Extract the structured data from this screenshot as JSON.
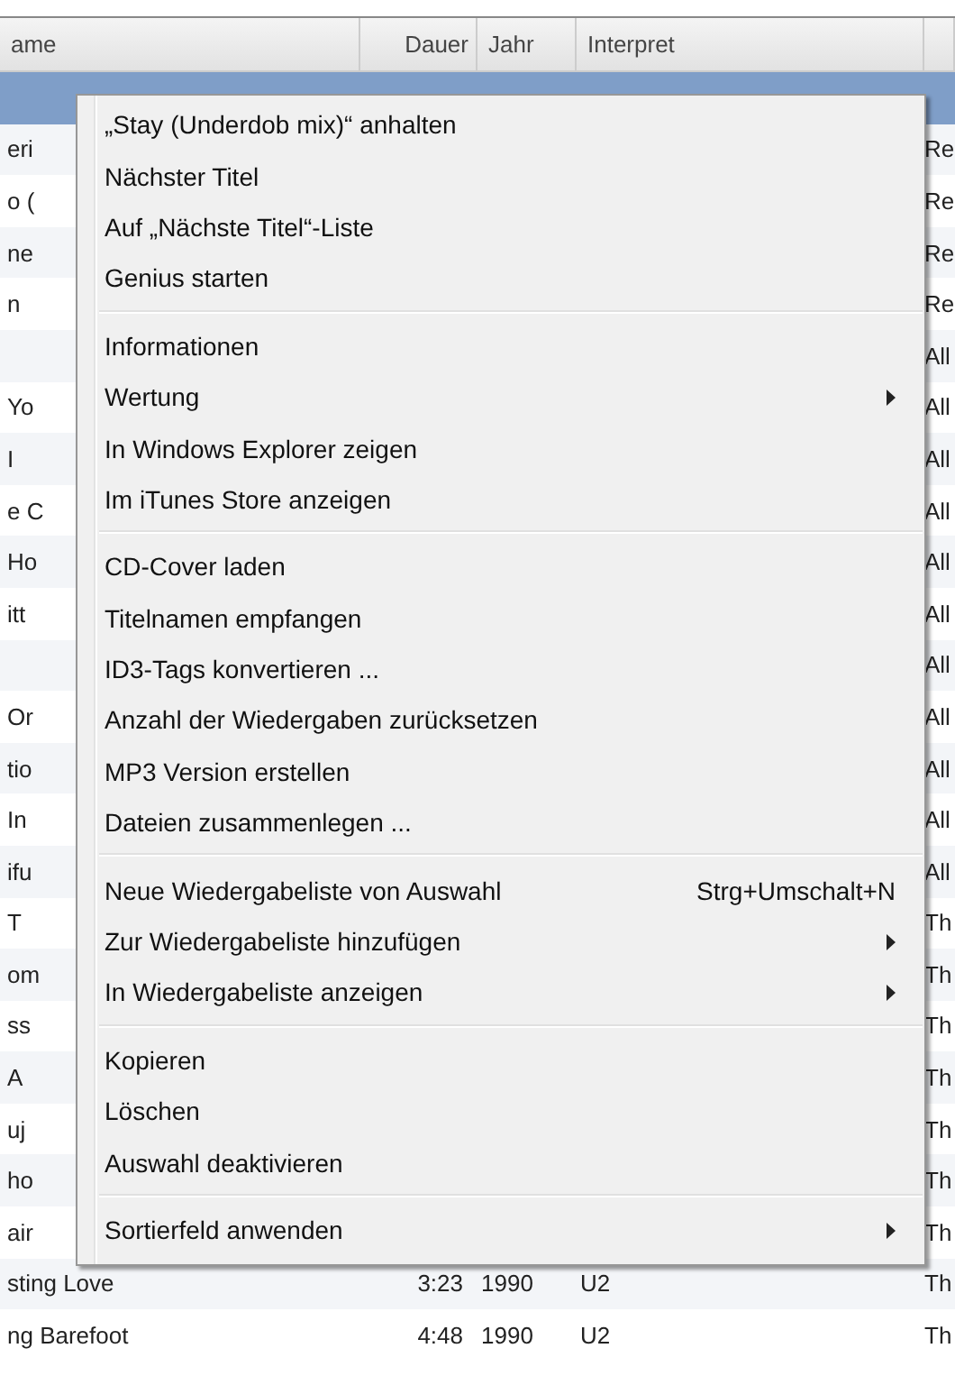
{
  "columns": [
    "ame",
    "Dauer",
    "Jahr",
    "Interpret"
  ],
  "rows": [
    {
      "name": "",
      "duration": "",
      "year": "",
      "artist": "",
      "album": "",
      "selected": true
    },
    {
      "name": "eri",
      "duration": "",
      "year": "",
      "artist": "",
      "album": "Re",
      "selected": false
    },
    {
      "name": "o (",
      "duration": "",
      "year": "",
      "artist": "",
      "album": "Re",
      "selected": false
    },
    {
      "name": "ne",
      "duration": "",
      "year": "",
      "artist": "",
      "album": "Re",
      "selected": false
    },
    {
      "name": "n",
      "duration": "",
      "year": "",
      "artist": "",
      "album": "Re",
      "selected": false
    },
    {
      "name": "",
      "duration": "",
      "year": "",
      "artist": "",
      "album": "All",
      "selected": false
    },
    {
      "name": "Yo",
      "duration": "",
      "year": "",
      "artist": "",
      "album": "All",
      "selected": false
    },
    {
      "name": "I",
      "duration": "",
      "year": "",
      "artist": "",
      "album": "All",
      "selected": false
    },
    {
      "name": "e C",
      "duration": "",
      "year": "",
      "artist": "",
      "album": "All",
      "selected": false
    },
    {
      "name": "Ho",
      "duration": "",
      "year": "",
      "artist": "",
      "album": "All",
      "selected": false
    },
    {
      "name": "itt",
      "duration": "",
      "year": "",
      "artist": "",
      "album": "All",
      "selected": false
    },
    {
      "name": "",
      "duration": "",
      "year": "",
      "artist": "",
      "album": "All",
      "selected": false
    },
    {
      "name": "Or",
      "duration": "",
      "year": "",
      "artist": "",
      "album": "All",
      "selected": false
    },
    {
      "name": "tio",
      "duration": "",
      "year": "",
      "artist": "",
      "album": "All",
      "selected": false
    },
    {
      "name": "In",
      "duration": "",
      "year": "",
      "artist": "",
      "album": "All",
      "selected": false
    },
    {
      "name": "ifu",
      "duration": "",
      "year": "",
      "artist": "",
      "album": "All",
      "selected": false
    },
    {
      "name": "T",
      "duration": "",
      "year": "",
      "artist": "",
      "album": "Th",
      "selected": false
    },
    {
      "name": "om",
      "duration": "",
      "year": "",
      "artist": "",
      "album": "Th",
      "selected": false
    },
    {
      "name": "ss",
      "duration": "",
      "year": "",
      "artist": "",
      "album": "Th",
      "selected": false
    },
    {
      "name": "A",
      "duration": "",
      "year": "",
      "artist": "",
      "album": "Th",
      "selected": false
    },
    {
      "name": "uj",
      "duration": "",
      "year": "",
      "artist": "",
      "album": "Th",
      "selected": false
    },
    {
      "name": "ho",
      "duration": "",
      "year": "",
      "artist": "",
      "album": "Th",
      "selected": false
    },
    {
      "name": "air",
      "duration": "",
      "year": "",
      "artist": "",
      "album": "Th",
      "selected": false
    },
    {
      "name": "sting Love",
      "duration": "3:23",
      "year": "1990",
      "artist": "U2",
      "album": "Th",
      "selected": false
    },
    {
      "name": "ng Barefoot",
      "duration": "4:48",
      "year": "1990",
      "artist": "U2",
      "album": "Th",
      "selected": false
    }
  ],
  "context_menu": [
    {
      "kind": "item",
      "label": "„Stay (Underdob mix)“ anhalten"
    },
    {
      "kind": "item",
      "label": "Nächster Titel"
    },
    {
      "kind": "item",
      "label": "Auf „Nächste Titel“-Liste"
    },
    {
      "kind": "item",
      "label": "Genius starten"
    },
    {
      "kind": "separator"
    },
    {
      "kind": "item",
      "label": "Informationen"
    },
    {
      "kind": "item",
      "label": "Wertung",
      "submenu": true
    },
    {
      "kind": "item",
      "label": "In Windows Explorer zeigen"
    },
    {
      "kind": "item",
      "label": "Im iTunes Store anzeigen"
    },
    {
      "kind": "separator"
    },
    {
      "kind": "item",
      "label": "CD-Cover laden"
    },
    {
      "kind": "item",
      "label": "Titelnamen empfangen"
    },
    {
      "kind": "item",
      "label": "ID3-Tags konvertieren ..."
    },
    {
      "kind": "item",
      "label": "Anzahl der Wiedergaben zurücksetzen"
    },
    {
      "kind": "item",
      "label": "MP3 Version erstellen"
    },
    {
      "kind": "item",
      "label": "Dateien zusammenlegen ..."
    },
    {
      "kind": "separator"
    },
    {
      "kind": "item",
      "label": "Neue Wiedergabeliste von Auswahl",
      "shortcut": "Strg+Umschalt+N"
    },
    {
      "kind": "item",
      "label": "Zur Wiedergabeliste hinzufügen",
      "submenu": true
    },
    {
      "kind": "item",
      "label": "In Wiedergabeliste anzeigen",
      "submenu": true
    },
    {
      "kind": "separator"
    },
    {
      "kind": "item",
      "label": "Kopieren"
    },
    {
      "kind": "item",
      "label": "Löschen"
    },
    {
      "kind": "item",
      "label": "Auswahl deaktivieren"
    },
    {
      "kind": "separator"
    },
    {
      "kind": "item",
      "label": "Sortierfeld anwenden",
      "submenu": true
    }
  ]
}
